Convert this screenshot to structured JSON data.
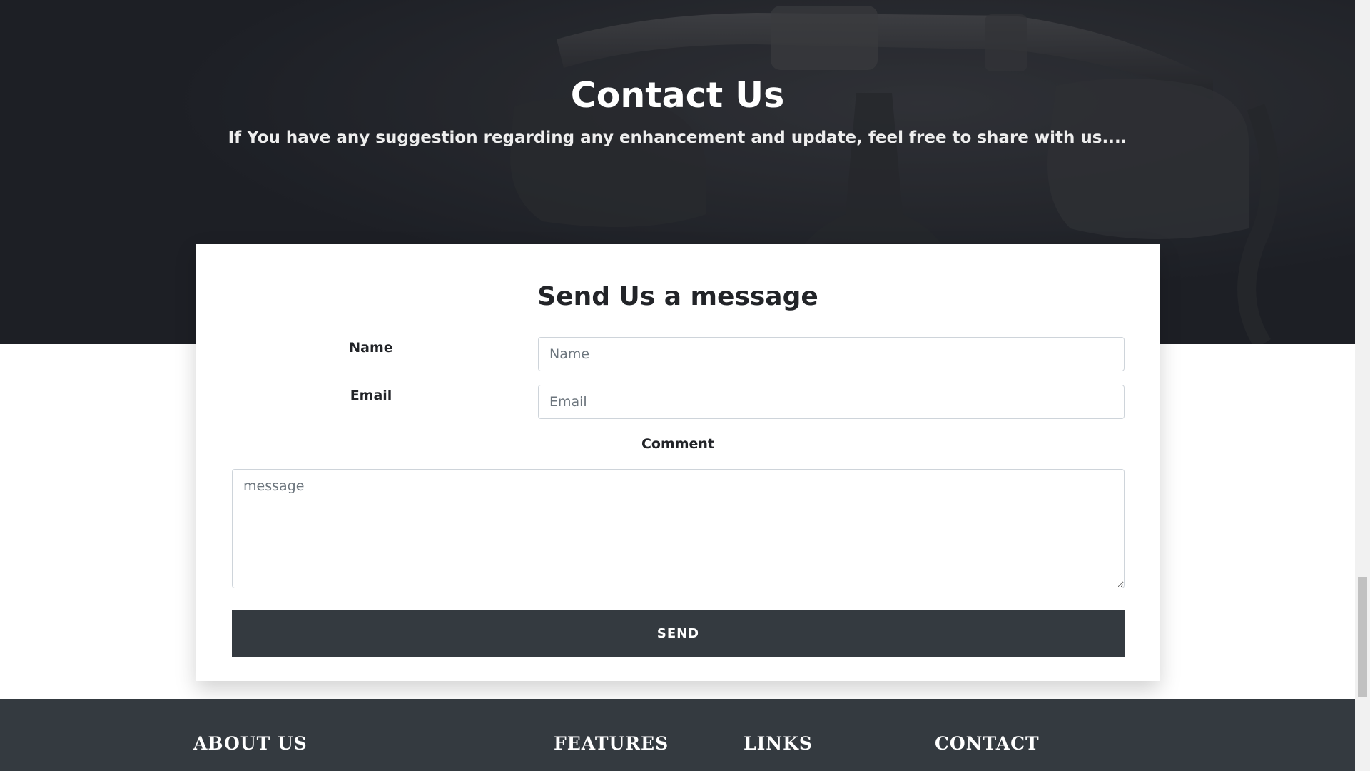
{
  "hero": {
    "title": "Contact Us",
    "subtitle": "If You have any suggestion regarding any enhancement and update, feel free to share with us...."
  },
  "form": {
    "title": "Send Us a message",
    "name_label": "Name",
    "name_placeholder": "Name",
    "email_label": "Email",
    "email_placeholder": "Email",
    "comment_label": "Comment",
    "message_placeholder": "message",
    "send_label": "SEND"
  },
  "footer": {
    "about_heading": "ABOUT US",
    "features_heading": "FEATURES",
    "links_heading": "LINKS",
    "contact_heading": "CONTACT"
  },
  "colors": {
    "hero_bg": "#1e2026",
    "button_bg": "#343a40",
    "footer_bg": "#343a40"
  }
}
